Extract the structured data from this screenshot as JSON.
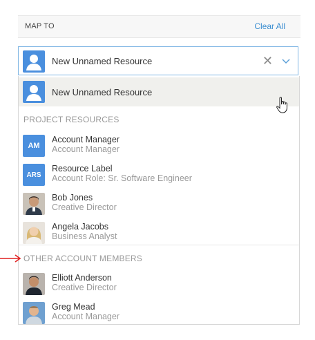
{
  "header": {
    "title": "MAP TO",
    "clear_label": "Clear All"
  },
  "select": {
    "value": "New Unnamed Resource",
    "clear_glyph": "✕",
    "avatar_icon": "person-icon",
    "chevron_icon": "chevron-down-icon"
  },
  "dropdown": {
    "hover_option": "New Unnamed Resource",
    "project_section": "PROJECT RESOURCES",
    "project_items": [
      {
        "initials": "AM",
        "name": "Account Manager",
        "sub": "Account Manager"
      },
      {
        "initials": "ARS",
        "name": "Resource Label",
        "sub": "Account Role: Sr. Software Engineer"
      },
      {
        "photo": "bob-photo",
        "name": "Bob Jones",
        "sub": "Creative Director"
      },
      {
        "photo": "angela-photo",
        "name": "Angela Jacobs",
        "sub": "Business Analyst"
      }
    ],
    "other_section": "OTHER ACCOUNT MEMBERS",
    "other_items": [
      {
        "photo": "elliott-photo",
        "name": "Elliott Anderson",
        "sub": "Creative Director"
      },
      {
        "photo": "greg-photo",
        "name": "Greg Mead",
        "sub": "Account Manager"
      }
    ]
  },
  "colors": {
    "accent": "#4a8fde",
    "link": "#3d8fd1",
    "arrow": "#e02020"
  }
}
